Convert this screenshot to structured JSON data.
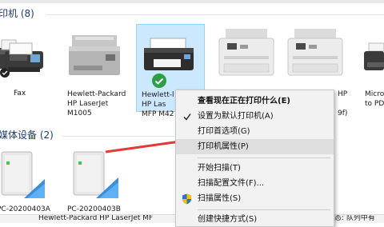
{
  "sections": {
    "printers_title": "印机 (8)",
    "media_title": "媒体设备 (2)"
  },
  "printers": [
    {
      "label": "",
      "icon": "printer-icon"
    },
    {
      "label": "Fax",
      "icon": "fax-icon"
    },
    {
      "label": "Hewlett-Packard HP LaserJet M1005",
      "line1": "Hewlett-Packard",
      "line2": "HP LaserJet",
      "line3": "M1005",
      "icon": "laser-printer-icon"
    },
    {
      "label": "Hewlett-Packard HP LaserJet MFP M42",
      "line1": "Hewlett-l",
      "line2": "HP Las",
      "line3": "MFP M42",
      "icon": "mfp-printer-icon",
      "selected": true,
      "default": true
    },
    {
      "label": "",
      "icon": "mfp-printer-icon"
    },
    {
      "line1": "HP",
      "line2": "9f)",
      "icon": "mfp-printer-icon"
    },
    {
      "line1": "Micro",
      "line2": "to PD",
      "icon": "printer-icon"
    }
  ],
  "media_devices": [
    {
      "label": "PC-20200403A",
      "icon": "media-server-icon"
    },
    {
      "label": "PC-20200403B",
      "icon": "media-server-icon"
    }
  ],
  "context_menu": {
    "items": [
      {
        "label": "查看现在正在打印什么(E)",
        "bold": true
      },
      {
        "label": "设置为默认打印机(A)",
        "checked": true
      },
      {
        "label": "打印首选项(G)"
      },
      {
        "label": "打印机属性(P)",
        "highlighted": true
      },
      {
        "separator": true
      },
      {
        "label": "开始扫描(T)"
      },
      {
        "label": "扫描配置文件(F)..."
      },
      {
        "label": "扫描属性(S)",
        "icon": "shield-icon"
      },
      {
        "separator": true
      },
      {
        "label": "创建快捷方式(S)"
      }
    ]
  },
  "status_bar": {
    "text": "Hewlett-Packard HP LaserJet MF",
    "right_text": "态:   队列中有"
  },
  "colors": {
    "selection_bg": "#cce8ff",
    "selection_border": "#99d1ff",
    "arrow": "#e53935",
    "section_title": "#1e3a6e",
    "check_badge": "#2e9e47"
  }
}
